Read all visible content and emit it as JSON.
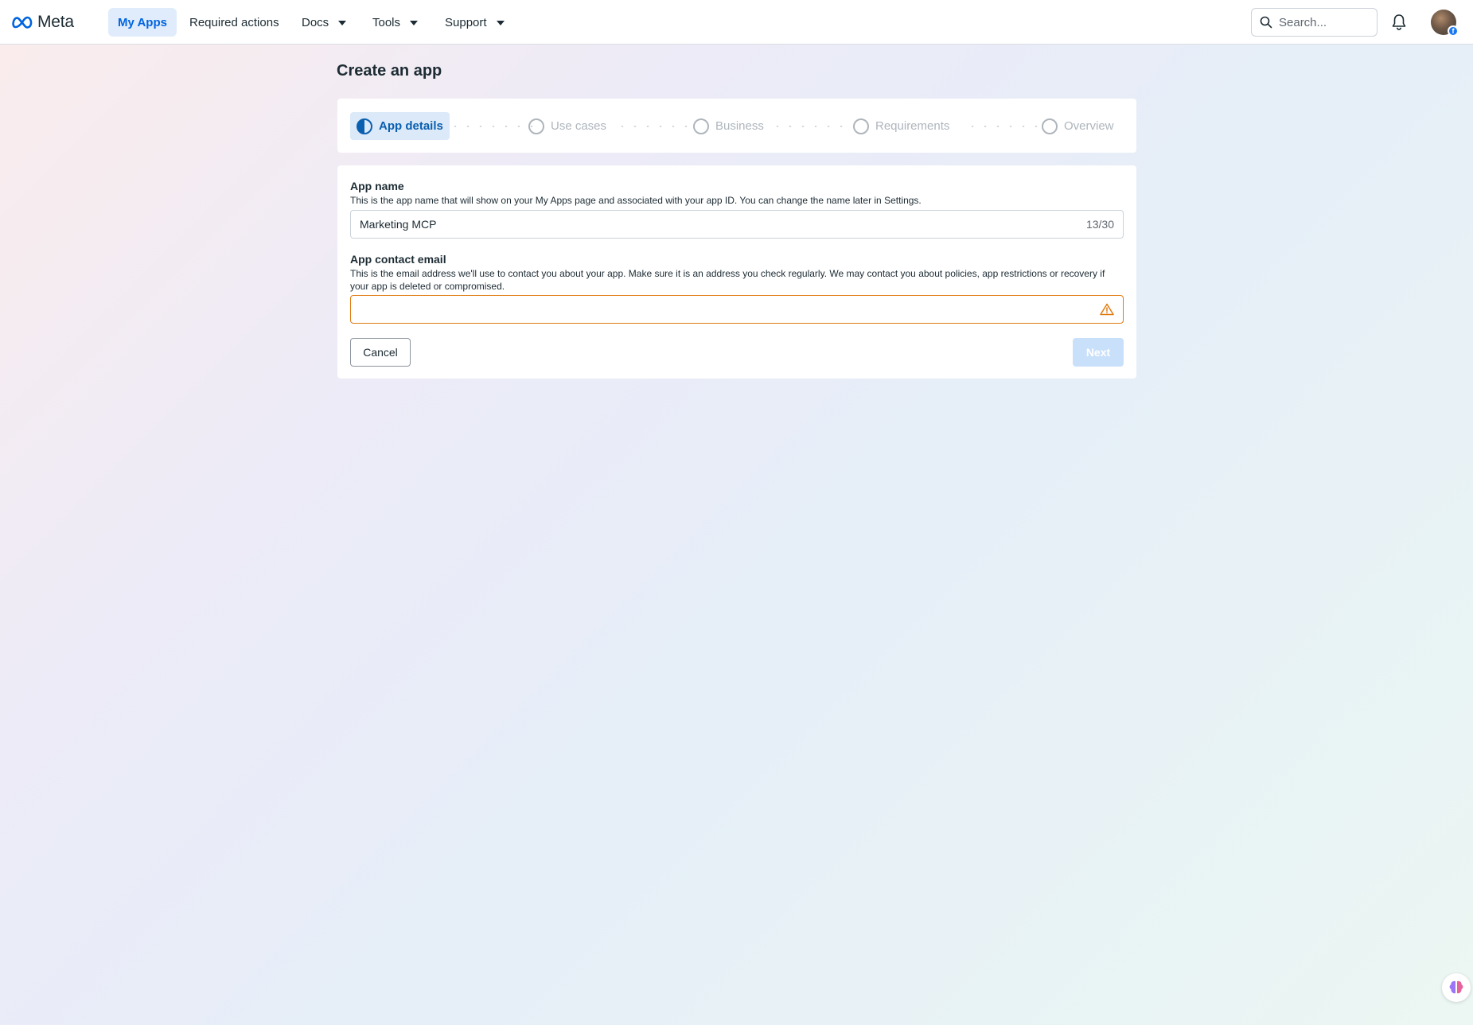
{
  "brand": {
    "name": "Meta",
    "logo_icon": "meta-infinity-logo",
    "color": "#0064e0"
  },
  "nav": {
    "items": [
      {
        "label": "My Apps",
        "active": true,
        "dropdown": false
      },
      {
        "label": "Required actions",
        "active": false,
        "dropdown": false
      },
      {
        "label": "Docs",
        "active": false,
        "dropdown": true
      },
      {
        "label": "Tools",
        "active": false,
        "dropdown": true
      },
      {
        "label": "Support",
        "active": false,
        "dropdown": true
      }
    ],
    "search_placeholder": "Search...",
    "notification_icon": "bell-icon",
    "avatar_badge": "f"
  },
  "page": {
    "title": "Create an app"
  },
  "stepper": {
    "steps": [
      {
        "label": "App details",
        "state": "in-progress"
      },
      {
        "label": "Use cases",
        "state": "pending"
      },
      {
        "label": "Business",
        "state": "pending"
      },
      {
        "label": "Requirements",
        "state": "pending"
      },
      {
        "label": "Overview",
        "state": "pending"
      }
    ]
  },
  "form": {
    "app_name": {
      "label": "App name",
      "help": "This is the app name that will show on your My Apps page and associated with your app ID. You can change the name later in Settings.",
      "value": "Marketing MCP",
      "char_count": "13/30"
    },
    "contact_email": {
      "label": "App contact email",
      "help": "This is the email address we'll use to contact you about your app. Make sure it is an address you check regularly. We may contact you about policies, app restrictions or recovery if your app is deleted or compromised.",
      "value": "",
      "status": "warning",
      "status_icon": "warning-triangle-icon"
    },
    "cancel_label": "Cancel",
    "next_label": "Next"
  },
  "colors": {
    "warning": "#e07a10",
    "active_step_bg": "#dbe9f8",
    "active_step_text": "#0a5fb0",
    "next_disabled_bg": "#c9e0fa"
  }
}
